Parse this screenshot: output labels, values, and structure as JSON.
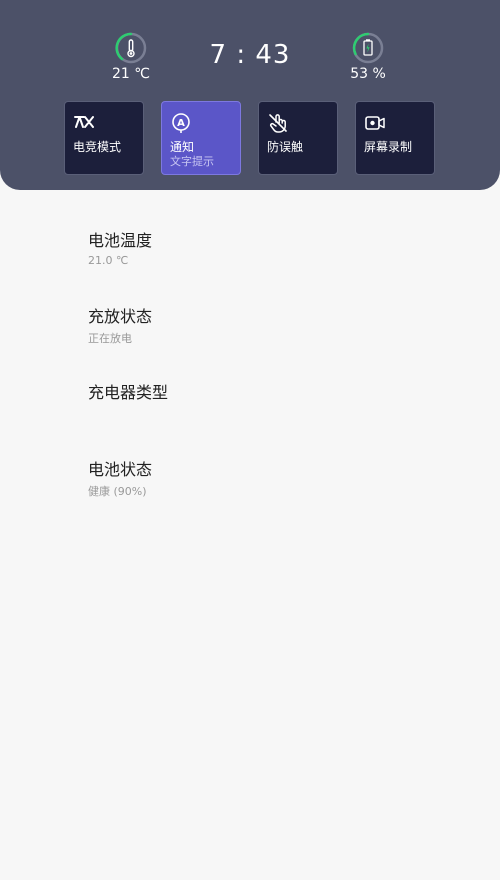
{
  "status": {
    "temperature": "21 ℃",
    "time": "7 : 43",
    "battery": "53 %"
  },
  "tiles": [
    {
      "icon": "game-mode-icon",
      "label": "电竞模式",
      "sub": "",
      "active": false
    },
    {
      "icon": "notification-icon",
      "label": "通知",
      "sub": "文字提示",
      "active": true
    },
    {
      "icon": "touch-guard-icon",
      "label": "防误触",
      "sub": "",
      "active": false
    },
    {
      "icon": "screen-record-icon",
      "label": "屏幕录制",
      "sub": "",
      "active": false
    }
  ],
  "list": [
    {
      "title": "电池温度",
      "sub": "21.0 ℃"
    },
    {
      "title": "充放状态",
      "sub": "正在放电"
    },
    {
      "title": "充电器类型",
      "sub": ""
    },
    {
      "title": "电池状态",
      "sub": "健康 (90%)"
    }
  ],
  "colors": {
    "panel": "#4c5168",
    "tile": "#1c1f3b",
    "tile_active": "#5b56c8",
    "ring_accent": "#2ecc71"
  }
}
